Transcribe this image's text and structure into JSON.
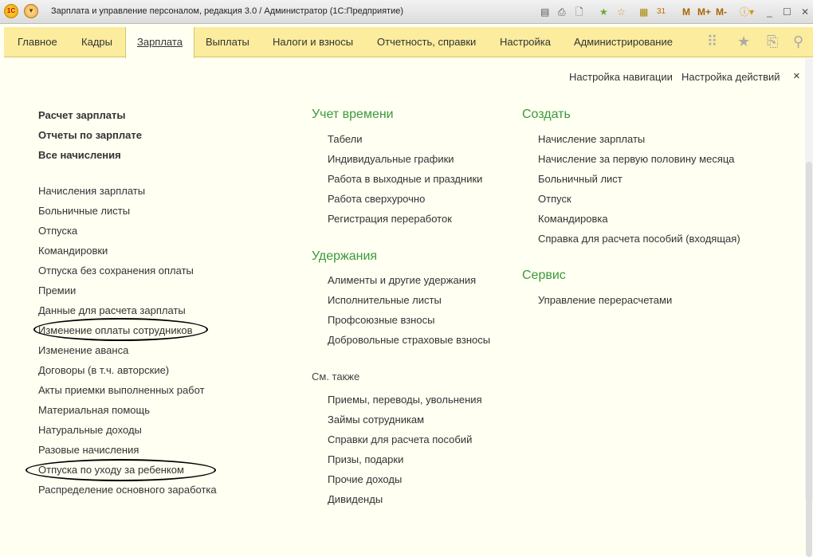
{
  "window": {
    "title": "Зарплата и управление персоналом, редакция 3.0 / Администратор  (1С:Предприятие)",
    "logo": "1С",
    "toolbar": [
      "M",
      "M+",
      "M-"
    ]
  },
  "nav": {
    "tabs": [
      "Главное",
      "Кадры",
      "Зарплата",
      "Выплаты",
      "Налоги и взносы",
      "Отчетность, справки",
      "Настройка",
      "Администрирование"
    ],
    "active": "Зарплата"
  },
  "top_links": {
    "nav_settings": "Настройка навигации",
    "action_settings": "Настройка действий",
    "close": "×"
  },
  "col1": {
    "bold": [
      "Расчет зарплаты",
      "Отчеты по зарплате",
      "Все начисления"
    ],
    "items": [
      "Начисления зарплаты",
      "Больничные листы",
      "Отпуска",
      "Командировки",
      "Отпуска без сохранения оплаты",
      "Премии",
      "Данные для расчета зарплаты",
      "Изменение оплаты сотрудников",
      "Изменение аванса",
      "Договоры (в т.ч. авторские)",
      "Акты приемки выполненных работ",
      "Материальная помощь",
      "Натуральные доходы",
      "Разовые начисления",
      "Отпуска по уходу за ребенком",
      "Распределение основного заработка"
    ]
  },
  "col2": {
    "time_heading": "Учет времени",
    "time": [
      "Табели",
      "Индивидуальные графики",
      "Работа в выходные и праздники",
      "Работа сверхурочно",
      "Регистрация переработок"
    ],
    "deductions_heading": "Удержания",
    "deductions": [
      "Алименты и другие удержания",
      "Исполнительные листы",
      "Профсоюзные взносы",
      "Добровольные страховые взносы"
    ],
    "see_also_heading": "См. также",
    "see_also": [
      "Приемы, переводы, увольнения",
      "Займы сотрудникам",
      "Справки для расчета пособий",
      "Призы, подарки",
      "Прочие доходы",
      "Дивиденды"
    ]
  },
  "col3": {
    "create_heading": "Создать",
    "create": [
      "Начисление зарплаты",
      "Начисление за первую половину месяца",
      "Больничный лист",
      "Отпуск",
      "Командировка",
      "Справка для расчета пособий (входящая)"
    ],
    "service_heading": "Сервис",
    "service": [
      "Управление перерасчетами"
    ]
  }
}
